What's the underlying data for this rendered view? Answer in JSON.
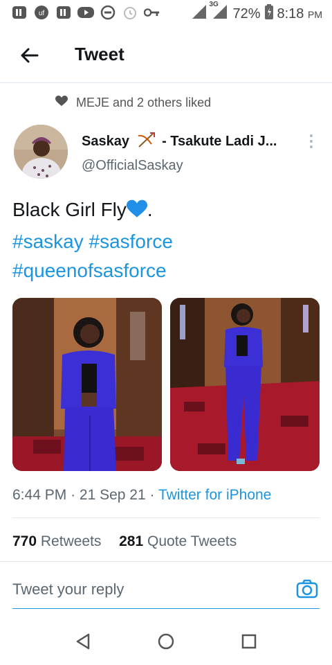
{
  "status_bar": {
    "network": "3G",
    "battery": "72%",
    "time": "8:18",
    "ampm": "PM"
  },
  "header": {
    "title": "Tweet"
  },
  "social_context": {
    "text": "MEJE and 2 others liked"
  },
  "author": {
    "name_part1": "Saskay",
    "name_part2": "- Tsakute Ladi J...",
    "handle": "@OfficialSaskay"
  },
  "tweet": {
    "text": "Black Girl Fly",
    "text_suffix": ".",
    "hashtags": [
      "#saskay",
      "#sasforce",
      "#queenofsasforce"
    ]
  },
  "meta": {
    "time": "6:44 PM",
    "date": "21 Sep 21",
    "source": "Twitter for iPhone"
  },
  "stats": {
    "retweets_count": "770",
    "retweets_label": "Retweets",
    "quotes_count": "281",
    "quotes_label": "Quote Tweets"
  },
  "reply": {
    "placeholder": "Tweet your reply"
  },
  "colors": {
    "link": "#1b95e0",
    "suit": "#3d2fd6",
    "carpet": "#b0172a"
  }
}
